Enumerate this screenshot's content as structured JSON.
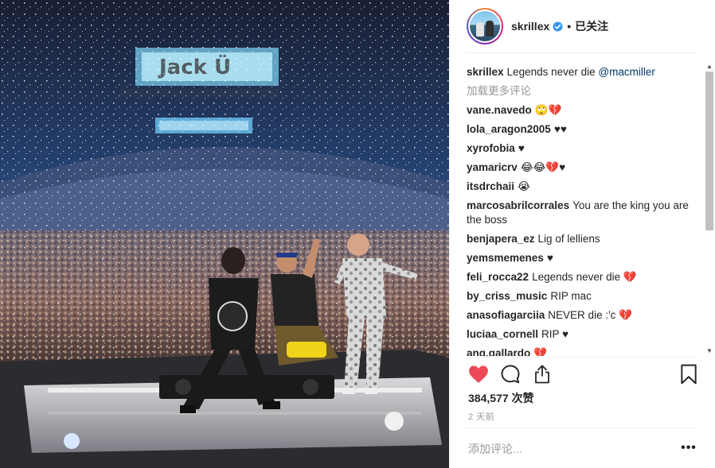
{
  "post": {
    "photo_alt": "",
    "header": {
      "username": "skrillex",
      "verified": true,
      "separator": "•",
      "follow_status": "已关注"
    },
    "caption": {
      "author": "skrillex",
      "text_before": "Legends never die ",
      "mention": "@macmiller"
    },
    "load_more_label": "加载更多评论",
    "comments": [
      {
        "author": "vane.navedo",
        "text": "🙄💔"
      },
      {
        "author": "lola_aragon2005",
        "text": "♥♥"
      },
      {
        "author": "xyrofobia",
        "text": "♥"
      },
      {
        "author": "yamaricrv",
        "text": "😂😂💔♥"
      },
      {
        "author": "itsdrchaii",
        "text": "😭"
      },
      {
        "author": "marcosabrilcorrales",
        "text": "You are the king you are the boss"
      },
      {
        "author": "benjapera_ez",
        "text": "Lig of lelliens"
      },
      {
        "author": "yemsmemenes",
        "text": "♥"
      },
      {
        "author": "feli_rocca22",
        "text": "Legends never die 💔"
      },
      {
        "author": "by_criss_music",
        "text": "RIP mac"
      },
      {
        "author": "anasofiagarciia",
        "text": "NEVER die :'c 💔"
      },
      {
        "author": "luciaa_cornell",
        "text": "RIP ♥"
      },
      {
        "author": "ang.gallardo",
        "text": "💔"
      }
    ],
    "likes": "384,577 次赞",
    "timestamp": "2 天前",
    "add_comment_placeholder": "添加评论...",
    "more_options": "•••",
    "colors": {
      "like_red": "#ed4956",
      "text_primary": "#262626",
      "text_muted": "#999999",
      "mention_blue": "#003569",
      "verified_blue": "#3897f0"
    },
    "icons": [
      "heart-icon",
      "comment-icon",
      "share-icon",
      "bookmark-icon",
      "verified-badge-icon"
    ]
  }
}
